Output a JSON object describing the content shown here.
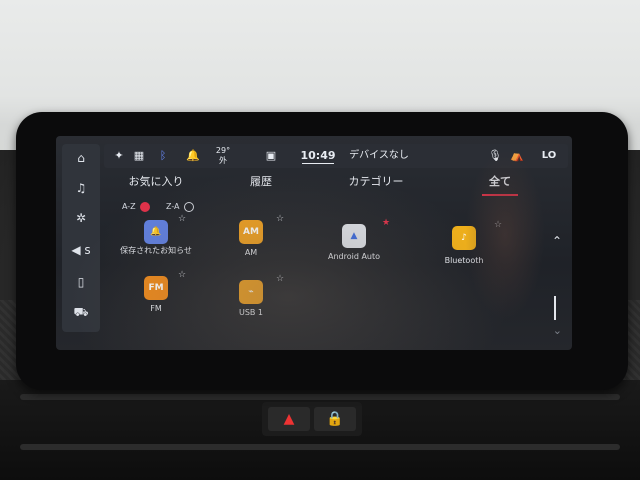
{
  "colors": {
    "accent": "#e0324a",
    "am": "#f0a020",
    "fm": "#f08a1a",
    "usb": "#f0a020",
    "android_auto": "#dfe3ea",
    "bluetooth": "#f0b01a",
    "saved": "#5f7fe0"
  },
  "sidebar": {
    "items": [
      {
        "icon": "home-icon",
        "glyph": "⌂"
      },
      {
        "icon": "music-note-icon",
        "glyph": "♫"
      },
      {
        "icon": "seat-fan-icon",
        "glyph": "✲"
      },
      {
        "icon": "volume-icon",
        "glyph": "◀ s"
      },
      {
        "icon": "phone-icon",
        "glyph": "▯"
      },
      {
        "icon": "car-icon",
        "glyph": "⛟"
      }
    ]
  },
  "topbar": {
    "seat_heat_icon": "seat-heat-icon",
    "apps_icon": "apps-grid-icon",
    "notification_icon": "bell-icon",
    "temperature": "29°",
    "temperature_label": "外",
    "phone_icon": "phone-connect-icon",
    "time": "10:49",
    "device_status": "デバイスなし",
    "mic_icon": "microphone-icon",
    "seat_icon": "seat-icon",
    "climate": "LO"
  },
  "tabs": [
    {
      "label": "お気に入り",
      "active": false
    },
    {
      "label": "履歴",
      "active": false
    },
    {
      "label": "カテゴリー",
      "active": false
    },
    {
      "label": "全て",
      "active": true
    }
  ],
  "sort": {
    "az_label": "A-Z",
    "za_label": "Z-A",
    "selected": "A-Z"
  },
  "sources": [
    {
      "id": "saved",
      "label": "保存されたお知らせ",
      "icon_text": "🔔",
      "favorite": false
    },
    {
      "id": "am",
      "label": "AM",
      "icon_text": "AM",
      "favorite": false
    },
    {
      "id": "android_auto",
      "label": "Android Auto",
      "icon_text": "▲",
      "favorite": true
    },
    {
      "id": "bluetooth",
      "label": "Bluetooth",
      "icon_text": "♪",
      "favorite": false
    },
    {
      "id": "fm",
      "label": "FM",
      "icon_text": "FM",
      "favorite": false
    },
    {
      "id": "usb",
      "label": "USB 1",
      "icon_text": "⌁",
      "favorite": false
    }
  ],
  "scroll": {
    "up_glyph": "⌃",
    "down_glyph": "⌄"
  }
}
